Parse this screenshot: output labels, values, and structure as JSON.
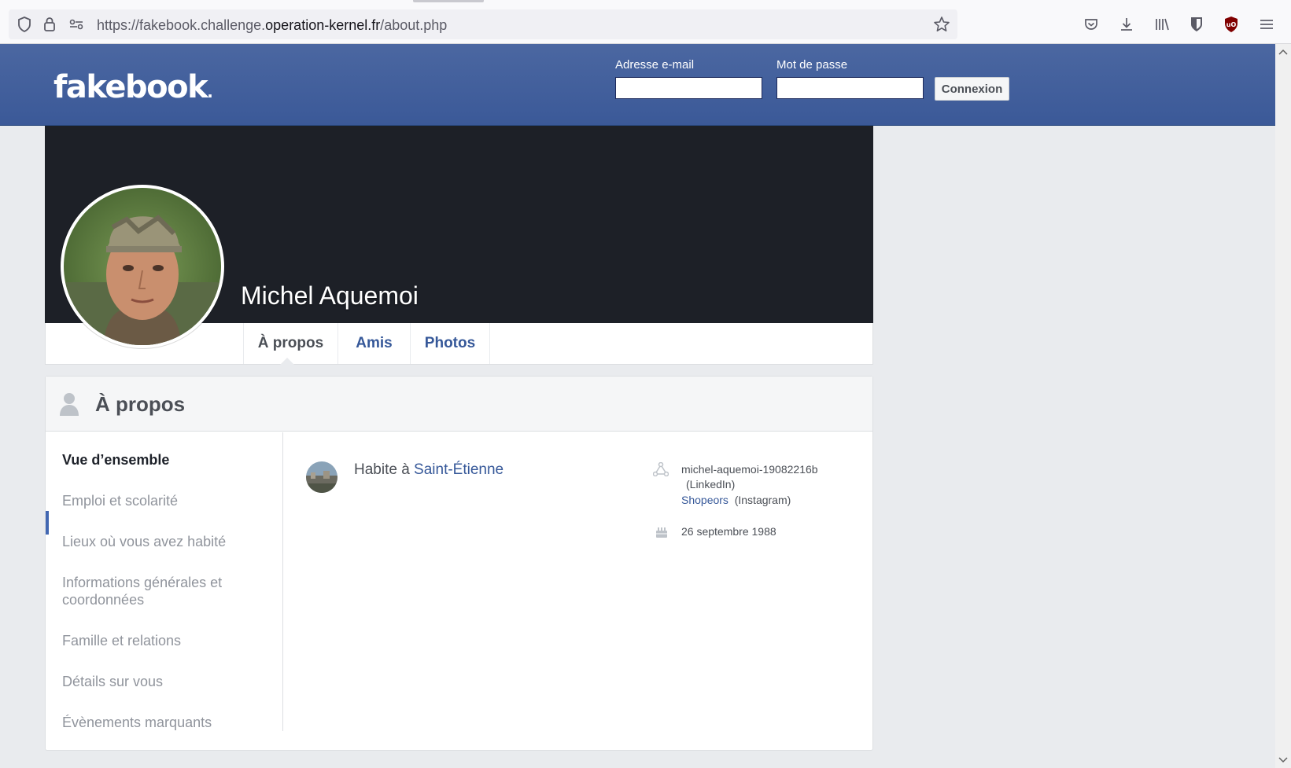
{
  "browser": {
    "url_prefix": "https://fakebook.challenge.",
    "url_host": "operation-kernel.fr",
    "url_path": "/about.php"
  },
  "header": {
    "logo": "fakebook",
    "logo_dot": ".",
    "email_label": "Adresse e-mail",
    "password_label": "Mot de passe",
    "login_button": "Connexion"
  },
  "profile": {
    "name": "Michel Aquemoi",
    "tabs": [
      {
        "label": "À propos"
      },
      {
        "label": "Amis"
      },
      {
        "label": "Photos"
      }
    ]
  },
  "about": {
    "title": "À propos",
    "nav": [
      {
        "label": "Vue d’ensemble"
      },
      {
        "label": "Emploi et scolarité"
      },
      {
        "label": "Lieux où vous avez habité"
      },
      {
        "label": "Informations générales et coordonnées"
      },
      {
        "label": "Famille et relations"
      },
      {
        "label": "Détails sur vous"
      },
      {
        "label": "Évènements marquants"
      }
    ],
    "lives_prefix": "Habite à ",
    "lives_city": "Saint-Étienne",
    "linkedin_handle": "michel-aquemoi-19082216b",
    "linkedin_label": "(LinkedIn)",
    "instagram_handle": "Shopeors",
    "instagram_label": "(Instagram)",
    "birthday": "26 septembre 1988"
  },
  "colors": {
    "brand": "#3b5998",
    "link": "#365899",
    "muted": "#90949c"
  }
}
